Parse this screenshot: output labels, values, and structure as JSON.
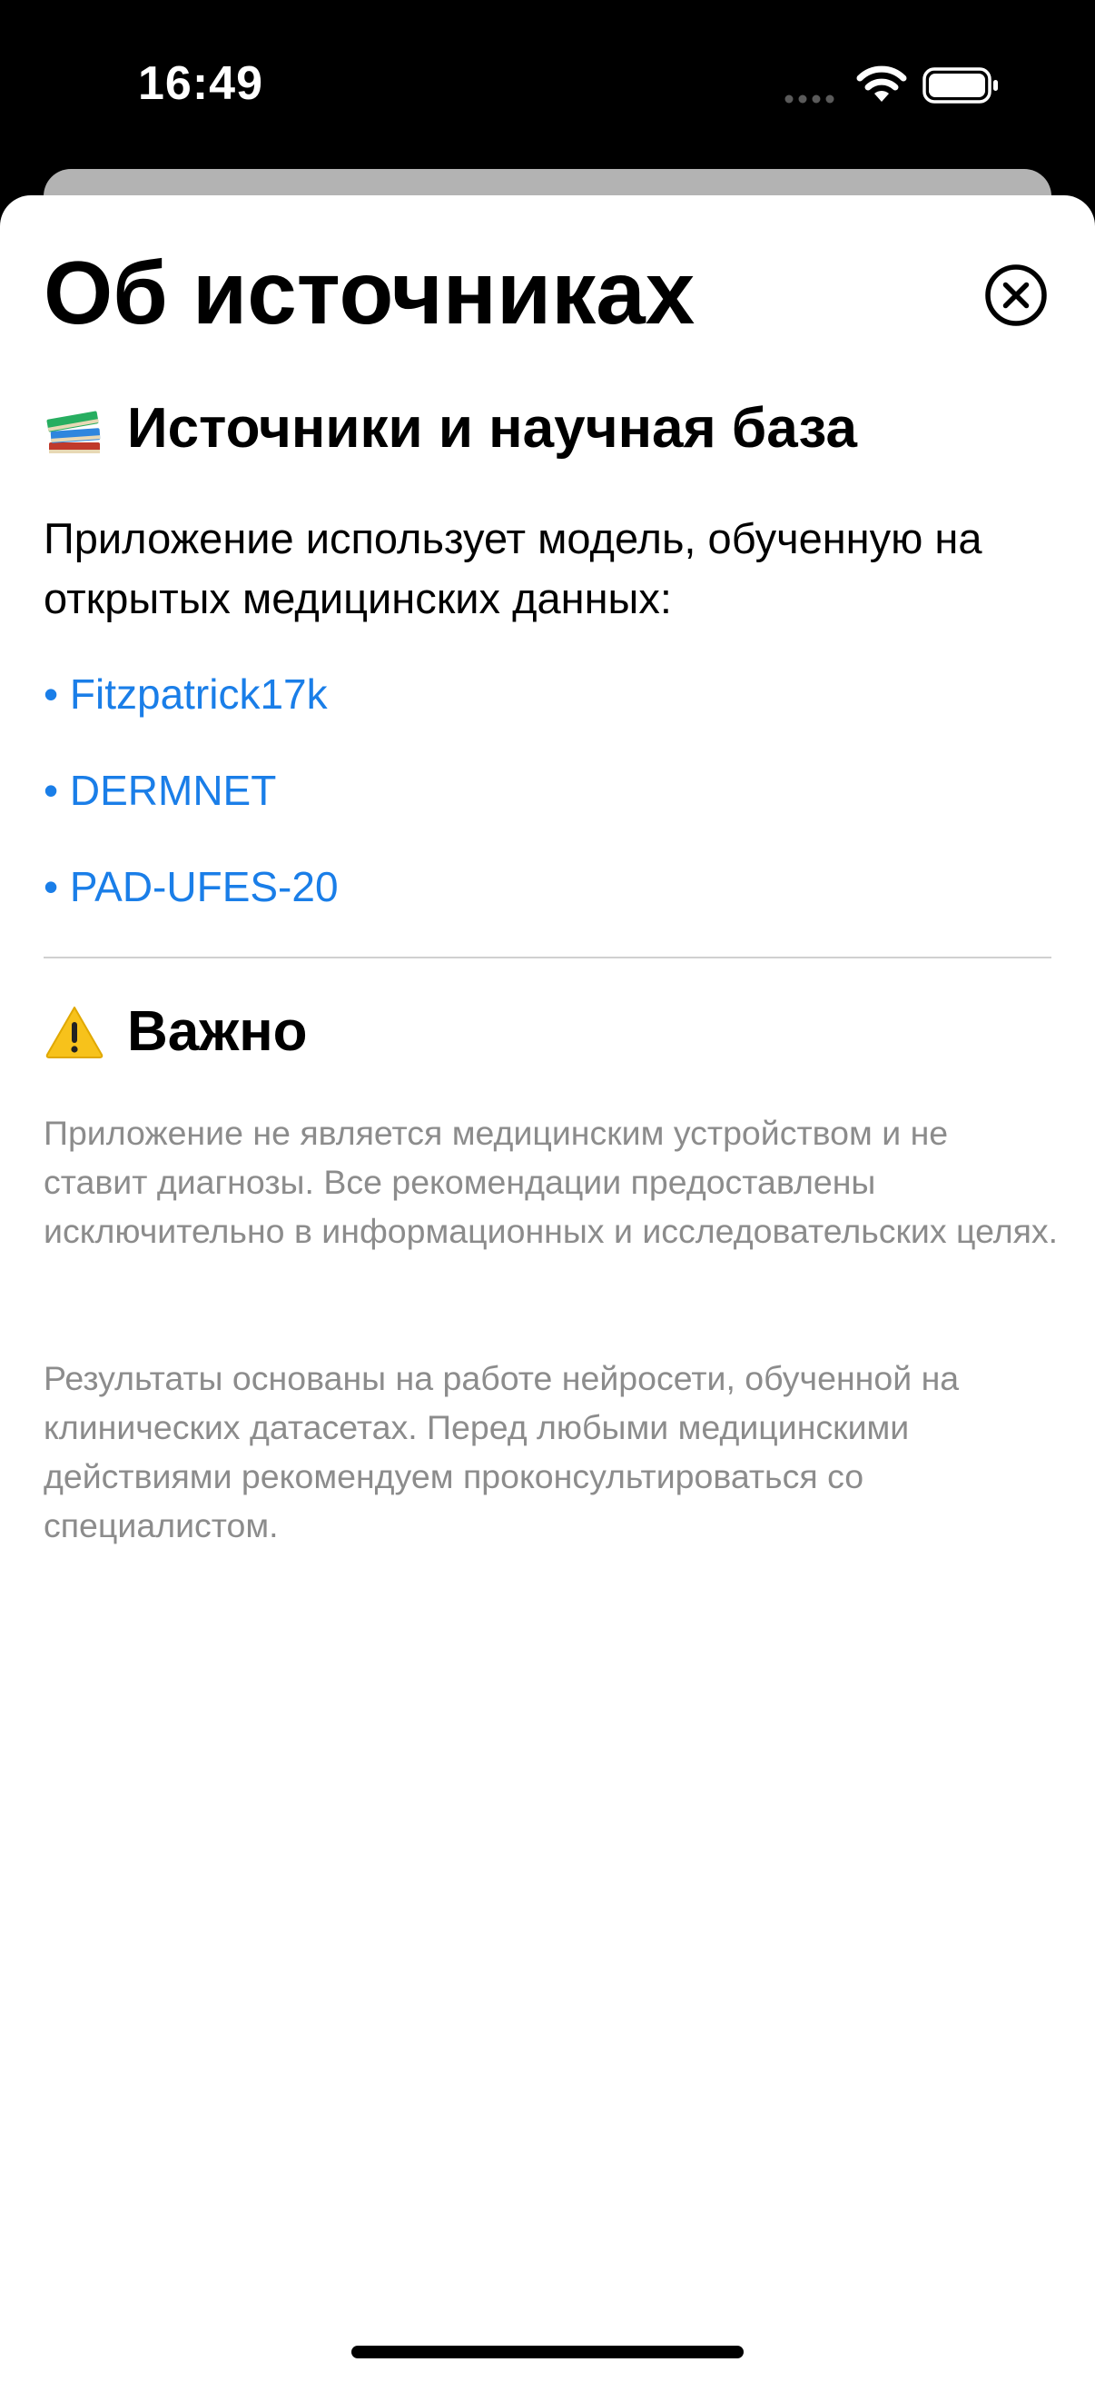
{
  "status_bar": {
    "time": "16:49",
    "icons": [
      "signal-dots-icon",
      "wifi-icon",
      "battery-icon"
    ]
  },
  "sheet": {
    "title": "Об источниках",
    "close_icon": "close-circle-icon",
    "sources_section": {
      "emoji": "books-emoji-icon",
      "heading": "Источники и научная база",
      "intro": "Приложение использует модель, обученную на открытых медицинских данных:",
      "links": [
        "• Fitzpatrick17k",
        "• DERMNET",
        "• PAD-UFES-20"
      ]
    },
    "important_section": {
      "emoji": "warning-emoji-icon",
      "heading": "Важно",
      "paragraphs": [
        "Приложение не является медицинским устройством и не ставит диагнозы. Все рекомендации предоставлены исключительно в информационных и исследовательских целях.",
        "Результаты основаны на работе нейросети, обученной на клинических датасетах. Перед любыми медицинскими действиями рекомендуем проконсультироваться со специалистом."
      ]
    }
  },
  "colors": {
    "link": "#1a7ee8",
    "secondary_text": "#8c8c8c",
    "divider": "#d0d0d0",
    "background_card": "#b3b3b3"
  }
}
